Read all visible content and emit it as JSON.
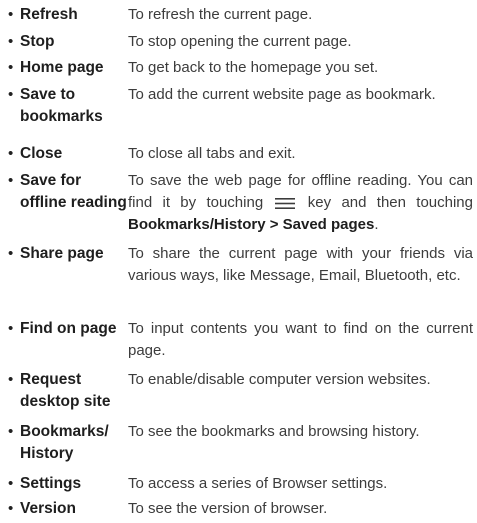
{
  "items": [
    {
      "term": "Refresh",
      "desc": "To refresh the current page."
    },
    {
      "term": "Stop",
      "desc": "To stop opening the current page."
    },
    {
      "term": "Home page",
      "desc": "To get back to the homepage you set."
    },
    {
      "term": "Save to bookmarks",
      "desc": "To add the current website page as bookmark."
    },
    {
      "term": "Close",
      "desc": "To close all tabs and exit."
    },
    {
      "term": "Save for offline reading",
      "desc_before": "To save the web page for offline reading. You can find it by touching",
      "desc_middle": "key and then touching",
      "desc_bold": "Bookmarks/History > Saved pages",
      "desc_after": "."
    },
    {
      "term": "Share page",
      "desc": "To share the current page with your friends via various ways, like Message, Email, Bluetooth, etc."
    },
    {
      "term": "Find on page",
      "desc": "To input contents you want to find on the current page."
    },
    {
      "term": "Request desktop site",
      "desc": "To enable/disable computer version websites."
    },
    {
      "term": "Bookmarks/ History",
      "desc": "To see the bookmarks and browsing history."
    },
    {
      "term": "Settings",
      "desc": "To access a series of Browser settings."
    },
    {
      "term": "Version",
      "desc": "To see the version of browser."
    }
  ],
  "bullet": "•",
  "icons": {
    "menu_key": "menu-key-icon"
  }
}
